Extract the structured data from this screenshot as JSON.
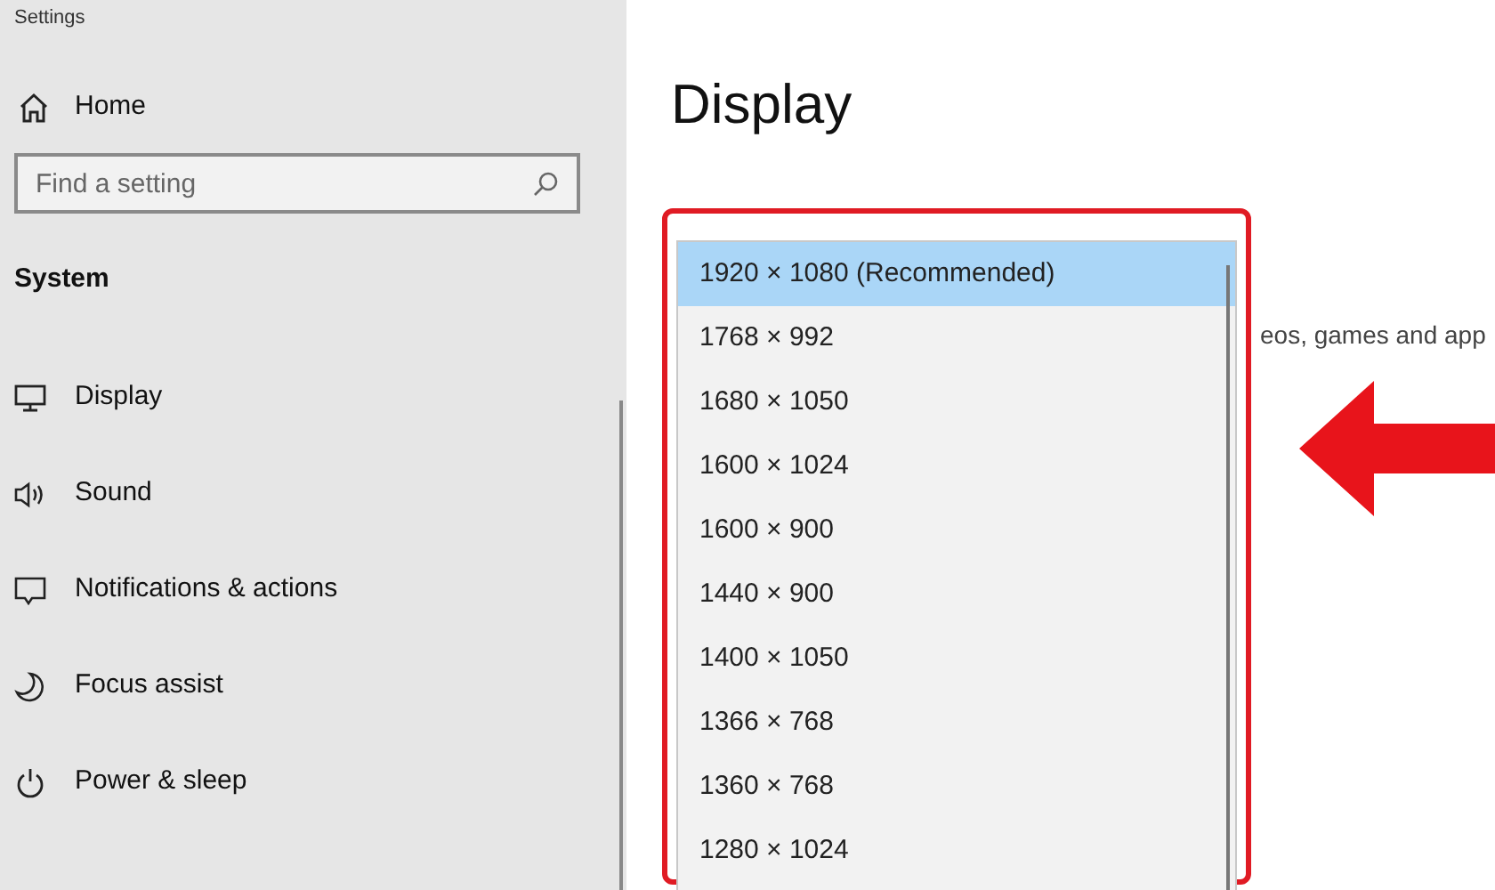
{
  "window": {
    "title": "Settings"
  },
  "sidebar": {
    "home": "Home",
    "search": {
      "placeholder": "Find a setting"
    },
    "section": "System",
    "items": [
      {
        "label": "Display"
      },
      {
        "label": "Sound"
      },
      {
        "label": "Notifications & actions"
      },
      {
        "label": "Focus assist"
      },
      {
        "label": "Power & sleep"
      }
    ]
  },
  "page": {
    "title": "Display",
    "background_text": "eos, games and app"
  },
  "resolution_dropdown": {
    "options": [
      {
        "label": "1920 × 1080 (Recommended)",
        "selected": true
      },
      {
        "label": "1768 × 992",
        "selected": false
      },
      {
        "label": "1680 × 1050",
        "selected": false
      },
      {
        "label": "1600 × 1024",
        "selected": false
      },
      {
        "label": "1600 × 900",
        "selected": false
      },
      {
        "label": "1440 × 900",
        "selected": false
      },
      {
        "label": "1400 × 1050",
        "selected": false
      },
      {
        "label": "1366 × 768",
        "selected": false
      },
      {
        "label": "1360 × 768",
        "selected": false
      },
      {
        "label": "1280 × 1024",
        "selected": false
      }
    ]
  }
}
